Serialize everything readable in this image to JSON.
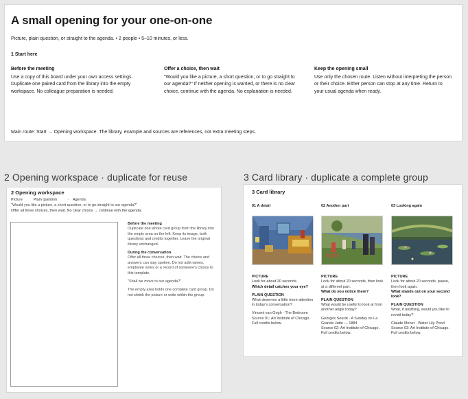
{
  "header": {
    "title": "A small opening for your one-on-one",
    "subtitle": "Picture, plain question, or straight to the agenda. • 2 people • 5–10 minutes, or less.",
    "section": "1 Start here",
    "main_route": "Main route: Start → Opening workspace. The library, example and sources are references, not extra meeting steps."
  },
  "columns": [
    {
      "heading": "Before the meeting",
      "body": "Use a copy of this board under your own access settings. Duplicate one paired card from the library into the empty workspace. No colleague preparation is needed."
    },
    {
      "heading": "Offer a choice, then wait",
      "body": "\"Would you like a picture, a short question, or to go straight to our agenda?\" If neither opening is wanted, or there is no clear choice, continue with the agenda. No explanation is needed."
    },
    {
      "heading": "Keep the opening small",
      "body": "Use only the chosen route. Listen without interpreting the person or their choice. Either person can stop at any time. Return to your usual agenda when ready."
    }
  ],
  "sections": {
    "workspace_heading": "2  Opening workspace · duplicate for reuse",
    "library_heading": "3  Card library · duplicate a complete group"
  },
  "workspace": {
    "title": "2 Opening workspace",
    "chips": [
      "Picture",
      "Plain question",
      "Agenda"
    ],
    "quote": "\"Would you like a picture, a short question, or to go straight to our agenda?\"",
    "offer": "Offer all three choices, then wait. No clear choice → continue with the agenda.",
    "before_heading": "Before the meeting",
    "before_body": "Duplicate one whole card group from the library into the empty area on the left. Keep its image, both questions and credits together. Leave the original library unchanged.",
    "during_heading": "During the conversation",
    "during_body": "Offer all three choices, then wait. The choice and answers can stay spoken. Do not add names, employee notes or a record of someone's choice to this template.",
    "agenda_prompt": "\"Shall we move to our agenda?\"",
    "empty_note": "The empty area holds one complete card group. Do not shrink the picture or write within the group."
  },
  "library": {
    "title": "3 Card library",
    "cards": [
      {
        "heading": "01 A detail",
        "picture_label": "PICTURE",
        "picture_text": "Look for about 20 seconds.",
        "picture_question": "Which detail catches your eye?",
        "plain_label": "PLAIN QUESTION",
        "plain_text": "What deserves a little more attention in today's conversation?",
        "credit_1": "Vincent van Gogh · The Bedroom",
        "credit_2": "Source 01: Art Institute of Chicago.",
        "credit_3": "Full credits below."
      },
      {
        "heading": "02 Another part",
        "picture_label": "PICTURE",
        "picture_text": "Look for about 20 seconds, then look at a different part.",
        "picture_question": "What do you notice there?",
        "plain_label": "PLAIN QUESTION",
        "plain_text": "What would be useful to look at from another angle today?",
        "credit_1": "Georges Seurat · A Sunday on La Grande Jatte — 1884",
        "credit_2": "Source 02: Art Institute of Chicago.",
        "credit_3": "Full credits below."
      },
      {
        "heading": "03 Looking again",
        "picture_label": "PICTURE",
        "picture_text": "Look for about 20 seconds, pause, then look again.",
        "picture_question": "What stands out on your second look?",
        "plain_label": "PLAIN QUESTION",
        "plain_text": "What, if anything, would you like to revisit today?",
        "credit_1": "Claude Monet · Water Lily Pond",
        "credit_2": "Source 03: Art Institute of Chicago.",
        "credit_3": "Full credits below."
      }
    ]
  }
}
